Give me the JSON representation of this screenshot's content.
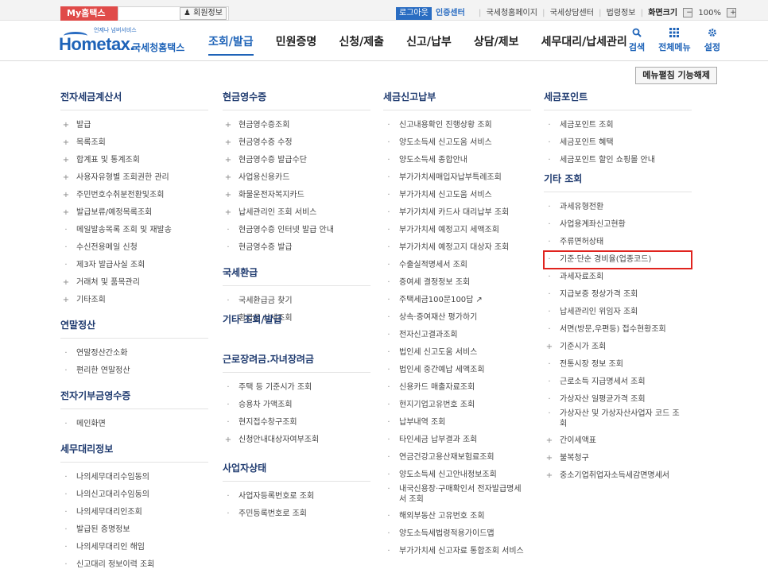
{
  "topbar": {
    "my_tab": "My홈택스",
    "member_info": "회원정보",
    "login": "로그아웃",
    "cert_center": "인증센터",
    "links": [
      "국세청홈페이지",
      "국세상담센터",
      "법령정보"
    ],
    "zoom_label": "화면크기",
    "zoom_minus": "−",
    "zoom_value": "100%",
    "zoom_plus": "+"
  },
  "header": {
    "logo_tag": "언제나 넘버서비스",
    "logo_main": "Hometax.",
    "logo_sub": "국세청홈택스",
    "nav": [
      "조회/발급",
      "민원증명",
      "신청/제출",
      "신고/납부",
      "상담/제보",
      "세무대리/납세관리"
    ],
    "active_nav_index": 0,
    "tools": [
      {
        "icon": "search-icon",
        "label": "검색"
      },
      {
        "icon": "grid-icon",
        "label": "전체메뉴"
      },
      {
        "icon": "gear-icon",
        "label": "설정"
      }
    ]
  },
  "fix_button": "메뉴펼침 기능해제",
  "columns": [
    {
      "sections": [
        {
          "title": "전자세금계산서",
          "items": [
            {
              "label": "발급",
              "mark": "plus"
            },
            {
              "label": "목록조회",
              "mark": "plus"
            },
            {
              "label": "합계표 및 통계조회",
              "mark": "plus"
            },
            {
              "label": "사용자유형별 조회권한 관리",
              "mark": "plus"
            },
            {
              "label": "주민번호수취분전환및조회",
              "mark": "plus"
            },
            {
              "label": "발급보류/예정목록조회",
              "mark": "plus"
            },
            {
              "label": "메일발송목록 조회 및 재발송",
              "mark": "dot"
            },
            {
              "label": "수신전용메일 신청",
              "mark": "dot"
            },
            {
              "label": "제3자 발급사실 조회",
              "mark": "dot"
            },
            {
              "label": "거래처 및 품목관리",
              "mark": "plus"
            },
            {
              "label": "기타조회",
              "mark": "plus"
            }
          ]
        },
        {
          "title": "연말정산",
          "items": [
            {
              "label": "연말정산간소화",
              "mark": "dot"
            },
            {
              "label": "편리한 연말정산",
              "mark": "dot"
            }
          ]
        },
        {
          "title": "전자기부금영수증",
          "items": [
            {
              "label": "메인화면",
              "mark": "dot"
            }
          ]
        },
        {
          "title": "세무대리정보",
          "items": [
            {
              "label": "나의세무대리수임동의",
              "mark": "dot"
            },
            {
              "label": "나의신고대리수임동의",
              "mark": "dot"
            },
            {
              "label": "나의세무대리인조회",
              "mark": "dot"
            },
            {
              "label": "발급된 증명정보",
              "mark": "dot"
            },
            {
              "label": "나의세무대리인 해임",
              "mark": "dot"
            },
            {
              "label": "신고대리 정보이력 조회",
              "mark": "dot"
            }
          ]
        }
      ]
    },
    {
      "sections": [
        {
          "title": "현금영수증",
          "items": [
            {
              "label": "현금영수증조회",
              "mark": "plus"
            },
            {
              "label": "현금영수증 수정",
              "mark": "plus"
            },
            {
              "label": "현금영수증 발급수단",
              "mark": "plus"
            },
            {
              "label": "사업용신용카드",
              "mark": "plus"
            },
            {
              "label": "화물운전자복지카드",
              "mark": "plus"
            },
            {
              "label": "납세관리인 조회 서비스",
              "mark": "plus"
            },
            {
              "label": "현금영수증 인터넷 발급 안내",
              "mark": "dot"
            },
            {
              "label": "현금영수증 발급",
              "mark": "dot"
            }
          ]
        },
        {
          "title": "국세환급",
          "items": [
            {
              "label": "국세환급금 찾기",
              "mark": "dot"
            },
            {
              "label": "환급금 상세조회",
              "mark": "dot"
            }
          ]
        },
        {
          "title": "기타 조회/발급",
          "items": []
        },
        {
          "title": "근로장려금.자녀장려금",
          "items": [
            {
              "label": "주택 등 기준시가 조회",
              "mark": "dot"
            },
            {
              "label": "승용차 가액조회",
              "mark": "dot"
            },
            {
              "label": "현지접수창구조회",
              "mark": "dot"
            },
            {
              "label": "신청안내대상자여부조회",
              "mark": "plus"
            }
          ]
        },
        {
          "title": "사업자상태",
          "items": [
            {
              "label": "사업자등록번호로 조회",
              "mark": "dot"
            },
            {
              "label": "주민등록번호로 조회",
              "mark": "dot"
            }
          ]
        }
      ]
    },
    {
      "sections": [
        {
          "title": "세금신고납부",
          "items": [
            {
              "label": "신고내용확인 진행상황 조회",
              "mark": "dot"
            },
            {
              "label": "양도소득세 신고도움 서비스",
              "mark": "dot"
            },
            {
              "label": "양도소득세 종합안내",
              "mark": "dot"
            },
            {
              "label": "부가가치세매입자납부특례조회",
              "mark": "dot"
            },
            {
              "label": "부가가치세 신고도움 서비스",
              "mark": "dot"
            },
            {
              "label": "부가가치세 카드사 대리납부 조회",
              "mark": "dot"
            },
            {
              "label": "부가가치세 예정고지 세액조회",
              "mark": "dot"
            },
            {
              "label": "부가가치세 예정고지 대상자 조회",
              "mark": "dot"
            },
            {
              "label": "수출실적명세서 조회",
              "mark": "dot"
            },
            {
              "label": "증여세 결정정보 조회",
              "mark": "dot"
            },
            {
              "label": "주택세금100문100답",
              "mark": "dot",
              "external": "↗"
            },
            {
              "label": "상속·증여재산 평가하기",
              "mark": "dot"
            },
            {
              "label": "전자신고결과조회",
              "mark": "dot"
            },
            {
              "label": "법인세 신고도움 서비스",
              "mark": "dot"
            },
            {
              "label": "법인세 중간예납 세액조회",
              "mark": "dot"
            },
            {
              "label": "신용카드 매출자료조회",
              "mark": "dot"
            },
            {
              "label": "현지기업고유번호 조회",
              "mark": "dot"
            },
            {
              "label": "납부내역 조회",
              "mark": "dot"
            },
            {
              "label": "타인세금 납부결과 조회",
              "mark": "dot"
            },
            {
              "label": "연금건강고용산재보험료조회",
              "mark": "dot"
            },
            {
              "label": "양도소득세 신고안내정보조회",
              "mark": "dot"
            },
            {
              "label": "내국신용장·구매확인서 전자발급명세서 조회",
              "mark": "dot",
              "two_line": true
            },
            {
              "label": "해외부동산 고유번호 조회",
              "mark": "dot"
            },
            {
              "label": "양도소득세법령적용가이드맵",
              "mark": "dot"
            },
            {
              "label": "부가가치세 신고자료 통합조회 서비스",
              "mark": "dot"
            }
          ]
        }
      ]
    },
    {
      "sections": [
        {
          "title": "세금포인트",
          "items": [
            {
              "label": "세금포인트 조회",
              "mark": "dot"
            },
            {
              "label": "세금포인트 혜택",
              "mark": "dot"
            },
            {
              "label": "세금포인트 할인 쇼핑몰 안내",
              "mark": "dot"
            }
          ]
        },
        {
          "title": "기타 조회",
          "items": [
            {
              "label": "과세유형전환",
              "mark": "dot"
            },
            {
              "label": "사업용계좌신고현황",
              "mark": "dot"
            },
            {
              "label": "주류면허상태",
              "mark": "dot"
            },
            {
              "label": "기준·단순 경비율(업종코드)",
              "mark": "dot",
              "highlight": true
            },
            {
              "label": "과세자료조회",
              "mark": "dot"
            },
            {
              "label": "지급보증 정상가격 조회",
              "mark": "dot"
            },
            {
              "label": "납세관리인 위임자 조회",
              "mark": "dot"
            },
            {
              "label": "서면(방문,우편등) 접수현황조회",
              "mark": "dot"
            },
            {
              "label": "기준시가 조회",
              "mark": "plus"
            },
            {
              "label": "전통시장 정보 조회",
              "mark": "dot"
            },
            {
              "label": "근로소득 지급명세서 조회",
              "mark": "dot"
            },
            {
              "label": "가상자산 일평균가격 조회",
              "mark": "dot"
            },
            {
              "label": "가상자산 및 가상자산사업자 코드 조회",
              "mark": "dot",
              "two_line": true
            },
            {
              "label": "간이세액표",
              "mark": "plus"
            },
            {
              "label": "불복청구",
              "mark": "plus"
            },
            {
              "label": "중소기업취업자소득세감면명세서",
              "mark": "plus"
            }
          ]
        }
      ]
    }
  ]
}
